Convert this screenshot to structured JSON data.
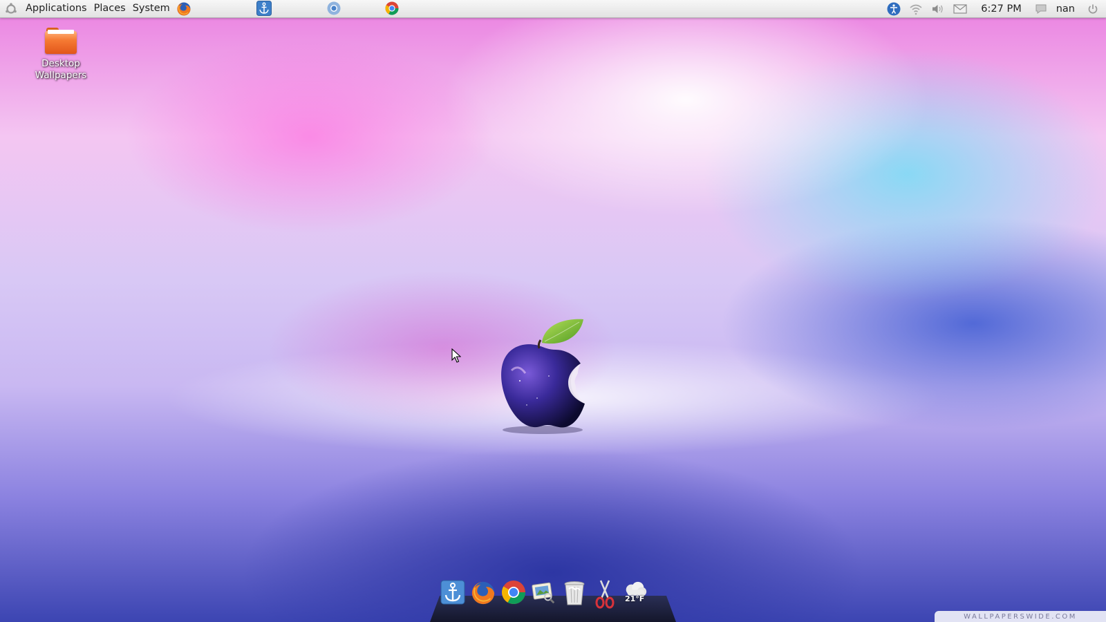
{
  "top_panel": {
    "menus": [
      "Applications",
      "Places",
      "System"
    ],
    "clock": "6:27 PM",
    "user": "nan",
    "icons": {
      "menu_logo": "distro-logo-icon",
      "launcher": "firefox-icon",
      "tasks": [
        "anchor-icon",
        "chromium-icon",
        "chrome-icon"
      ],
      "tray": [
        "accessibility-icon",
        "wifi-icon",
        "volume-icon",
        "mail-icon",
        "chat-icon",
        "power-icon"
      ]
    }
  },
  "desktop_icons": [
    {
      "label": "Desktop Wallpapers",
      "icon": "folder-icon"
    }
  ],
  "dock": {
    "items": [
      "anchor-icon",
      "firefox-icon",
      "chrome-icon",
      "image-viewer-icon",
      "trash-icon",
      "scissors-icon",
      "weather-icon"
    ],
    "weather_temp": "21°F"
  },
  "watermark": "WALLPAPERSWIDE.COM",
  "colors": {
    "panel": "#e6e6e6",
    "folder": "#f57a33",
    "dock": "#1a1c2e"
  }
}
